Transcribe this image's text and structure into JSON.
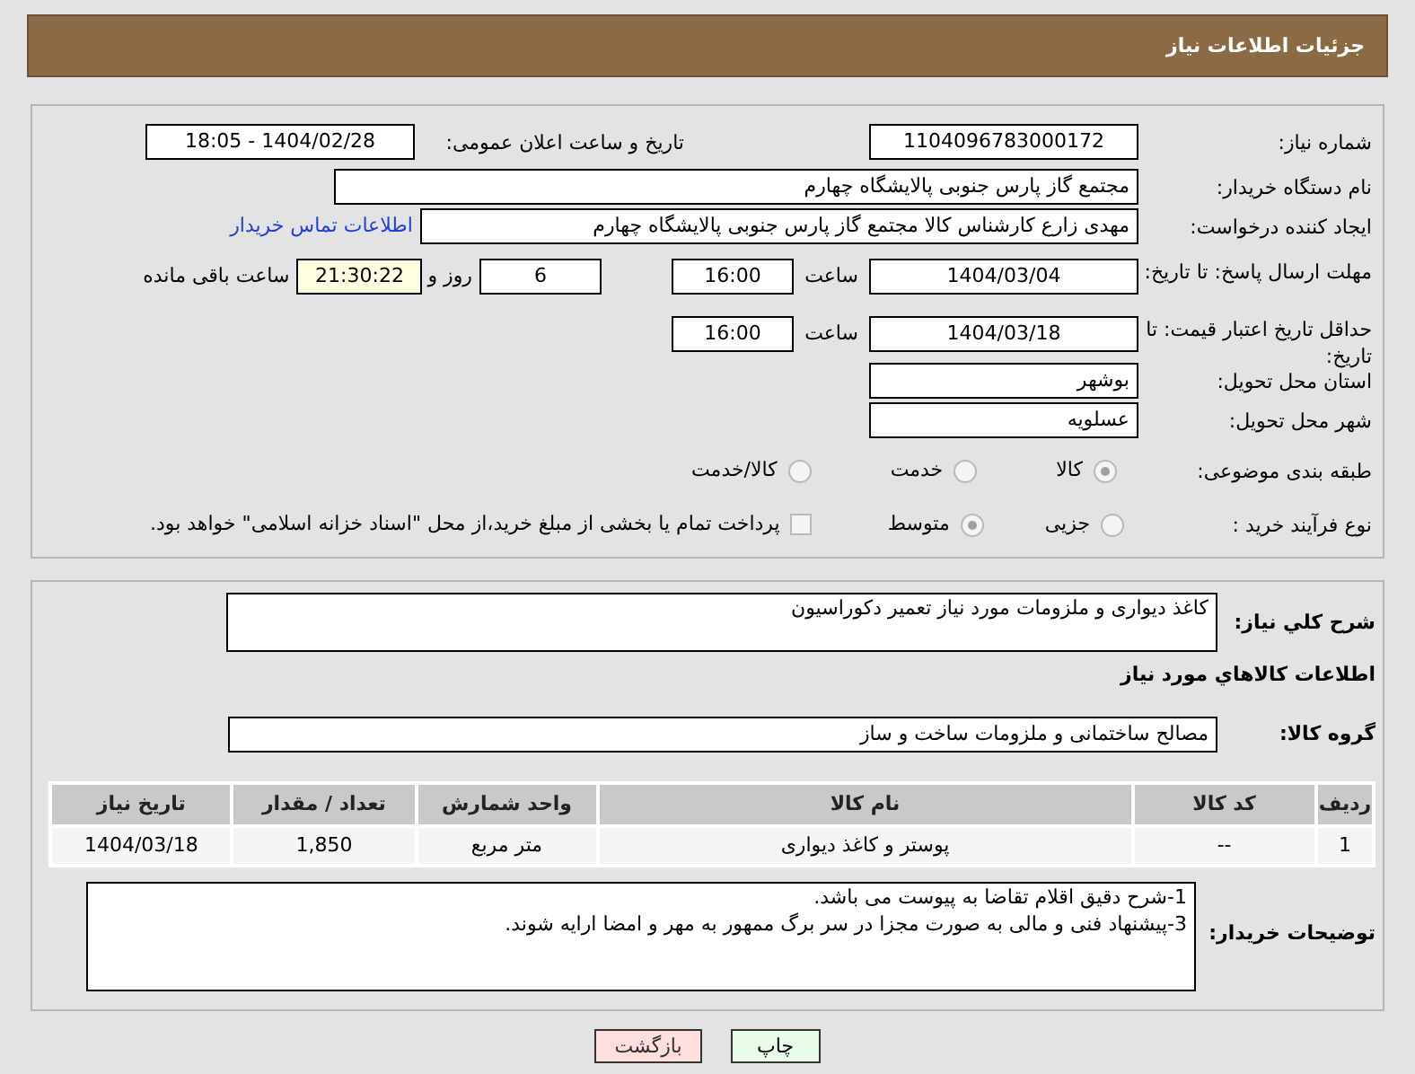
{
  "header": {
    "title": "جزئیات اطلاعات نیاز"
  },
  "details": {
    "need_number": {
      "label": "شماره نیاز:",
      "value": "1104096783000172"
    },
    "announce": {
      "label": "تاریخ و ساعت اعلان عمومی:",
      "value": "1404/02/28 - 18:05"
    },
    "buyer_org": {
      "label": "نام دستگاه خریدار:",
      "value": "مجتمع گاز پارس جنوبی  پالایشگاه چهارم"
    },
    "requester": {
      "label": "ایجاد کننده درخواست:",
      "value": "مهدی زارع کارشناس کالا مجتمع گاز پارس جنوبی  پالایشگاه چهارم",
      "link": "اطلاعات تماس خریدار"
    },
    "response_deadline": {
      "label": "مهلت ارسال پاسخ: تا تاریخ:",
      "date": "1404/03/04",
      "time_label": "ساعت",
      "time": "16:00",
      "days": "6",
      "days_label": "روز و",
      "remaining": "21:30:22",
      "remaining_label": "ساعت باقی مانده"
    },
    "price_validity": {
      "label": "حداقل تاریخ اعتبار قیمت: تا تاریخ:",
      "date": "1404/03/18",
      "time_label": "ساعت",
      "time": "16:00"
    },
    "province": {
      "label": "استان محل تحویل:",
      "value": "بوشهر"
    },
    "city": {
      "label": "شهر محل تحویل:",
      "value": "عسلویه"
    },
    "category": {
      "label": "طبقه بندی موضوعی:",
      "options": [
        {
          "label": "کالا",
          "selected": true
        },
        {
          "label": "خدمت",
          "selected": false
        },
        {
          "label": "کالا/خدمت",
          "selected": false
        }
      ]
    },
    "purchase_type": {
      "label": "نوع فرآیند خرید :",
      "options": [
        {
          "label": "جزیی",
          "selected": false
        },
        {
          "label": "متوسط",
          "selected": true
        }
      ],
      "payment": {
        "label": "پرداخت تمام یا بخشی از مبلغ خرید،از محل \"اسناد خزانه اسلامی\" خواهد بود.",
        "checked": false
      }
    }
  },
  "need": {
    "description": {
      "label": "شرح کلي نياز:",
      "value": "کاغذ دیواری و ملزومات مورد نیاز تعمیر دکوراسیون"
    },
    "items_heading": "اطلاعات کالاهاي مورد نياز",
    "goods_group": {
      "label": "گروه کالا:",
      "value": "مصالح ساختمانی و ملزومات ساخت و ساز"
    },
    "table": {
      "columns": [
        "ردیف",
        "کد کالا",
        "نام کالا",
        "واحد شمارش",
        "تعداد / مقدار",
        "تاریخ نیاز"
      ],
      "rows": [
        [
          "1",
          "--",
          "پوستر و کاغذ دیواری",
          "متر مربع",
          "1,850",
          "1404/03/18"
        ]
      ]
    },
    "buyer_notes": {
      "label": "توضیحات خریدار:",
      "lines": [
        "1-شرح دقیق اقلام تقاضا به پیوست می باشد.",
        "3-پیشنهاد فنی و مالی به صورت مجزا در سر برگ ممهور به مهر و امضا ارایه شوند."
      ]
    }
  },
  "buttons": [
    {
      "kind": "print",
      "label": "چاپ"
    },
    {
      "kind": "back",
      "label": "بازگشت"
    }
  ]
}
